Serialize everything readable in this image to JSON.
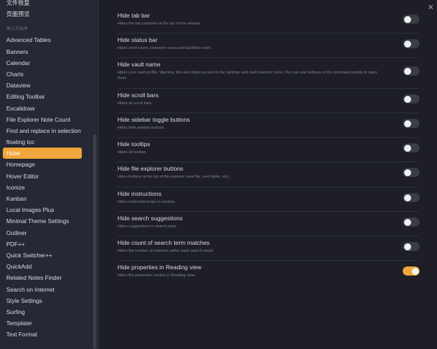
{
  "sidebar": {
    "top_items": [
      "文件恢复",
      "页面预览"
    ],
    "section_heading": "第三方插件",
    "items": [
      "Advanced Tables",
      "Banners",
      "Calendar",
      "Charts",
      "Dataview",
      "Editing Toolbar",
      "Excalidraw",
      "File Explorer Note Count",
      "Find and replace in selection",
      "floating toc",
      "Hider",
      "Homepage",
      "Hover Editor",
      "Iconize",
      "Kanban",
      "Local Images Plus",
      "Minimal Theme Settings",
      "Outliner",
      "PDF++",
      "Quick Switcher++",
      "QuickAdd",
      "Related Notes Finder",
      "Search on Internet",
      "Style Settings",
      "Surfing",
      "Templater",
      "Text Format"
    ],
    "active_item": "Hider"
  },
  "close_icon": "✕",
  "settings": [
    {
      "name": "Hide tab bar",
      "desc": "Hides the tab container at the top of the window.",
      "enabled": false
    },
    {
      "name": "Hide status bar",
      "desc": "Hides word count, character count and backlink count.",
      "enabled": false
    },
    {
      "name": "Hide vault name",
      "desc": "Hides your vault profile. Warning: this also hides access to the Settings and vault switcher icons. You can use hotkeys or the command palette to open them.",
      "enabled": false
    },
    {
      "name": "Hide scroll bars",
      "desc": "Hides all scroll bars.",
      "enabled": false
    },
    {
      "name": "Hide sidebar toggle buttons",
      "desc": "Hides both sidebar buttons.",
      "enabled": false
    },
    {
      "name": "Hide tooltips",
      "desc": "Hides all tooltips.",
      "enabled": false
    },
    {
      "name": "Hide file explorer buttons",
      "desc": "Hides buttons at the top of file explorer (new file, new folder, etc).",
      "enabled": false
    },
    {
      "name": "Hide instructions",
      "desc": "Hides instructional tips in modals.",
      "enabled": false
    },
    {
      "name": "Hide search suggestions",
      "desc": "Hides suggestions in search pane.",
      "enabled": false
    },
    {
      "name": "Hide count of search term matches",
      "desc": "Hides the number of matches within each search result.",
      "enabled": false
    },
    {
      "name": "Hide properties in Reading view",
      "desc": "Hides the properties section in Reading view.",
      "enabled": true
    }
  ]
}
